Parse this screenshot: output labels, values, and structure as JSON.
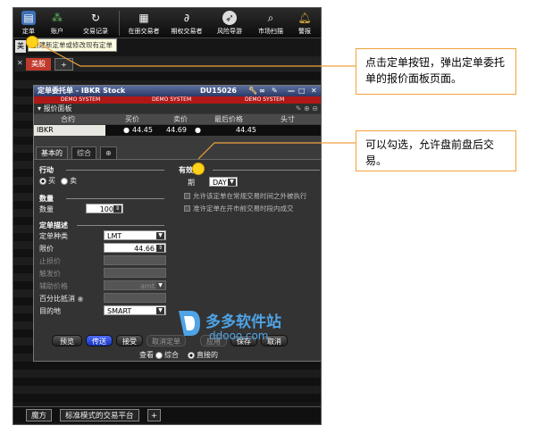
{
  "colors": {
    "accent": "#ffd21a",
    "callout_border": "#f2a23c",
    "title_blue": "#2c3a66",
    "demo_red": "#b01818",
    "button_blue": "#1633bb",
    "watermark": "#4ea4e6"
  },
  "toolbar": {
    "buttons": [
      {
        "label": "定单",
        "icon": "order-icon"
      },
      {
        "label": "账户",
        "icon": "account-icon"
      },
      {
        "label": "交易记录",
        "icon": "trade-log-icon"
      },
      {
        "label": "在册交易者",
        "icon": "book-trader-icon"
      },
      {
        "label": "期权交易者",
        "icon": "option-trader-icon"
      },
      {
        "label": "风险导游",
        "icon": "risk-navigator-icon"
      },
      {
        "label": "市场扫描",
        "icon": "market-scanner-icon"
      },
      {
        "label": "警报",
        "icon": "alert-icon"
      }
    ]
  },
  "tooltip": "创建新定单或修改现有定单",
  "stub_tab": "美",
  "workspace_tabs": {
    "active": "美股",
    "add": "+"
  },
  "order_window": {
    "title": "定单委托单 - IBKR Stock",
    "account": "DU15026",
    "demo_text": "DEMO SYSTEM",
    "quote_panel_title": "报价面板",
    "columns": [
      "合约",
      "买价",
      "卖价",
      "最后价格",
      "头寸"
    ],
    "row": {
      "contract": "IBKR",
      "bid": "44.45",
      "ask": "44.69",
      "last": "44.45",
      "position": ""
    },
    "tabs": [
      "基本的",
      "综合"
    ],
    "action_section": "行动",
    "buy": "买",
    "sell": "卖",
    "quantity_section": "数量",
    "quantity_label": "数量",
    "quantity_value": "100",
    "desc_section": "定单描述",
    "order_type_label": "定单种类",
    "order_type_value": "LMT",
    "limit_label": "限价",
    "limit_value": "44.66",
    "stop_label": "止损价",
    "trigger_label": "触发价",
    "aux_label": "辅助价格",
    "aux_value": "amt",
    "pct_label": "百分比抵消",
    "dest_label": "目的地",
    "dest_value": "SMART",
    "validity_section": "有效期",
    "tif_label": "期",
    "tif_value": "DAY",
    "check_outside_rth": "允许该定单在常规交易时间之外被执行",
    "check_premarket": "准许定单在开市前交易时段内成交",
    "buttons": {
      "preview": "预览",
      "transmit": "传送",
      "accept": "接受",
      "cancel_order": "取消定单",
      "apply": "应用",
      "save": "保存",
      "close": "取消"
    },
    "view_label": "查看",
    "view_all": "综合",
    "view_selected": "直接的"
  },
  "bottom_tabs": {
    "tab1": "魔方",
    "tab2": "标准模式的交易平台",
    "add": "+"
  },
  "callouts": {
    "one": "点击定单按钮，弹出定单委托单的报价面板页面。",
    "two": "可以勾选，允许盘前盘后交易。"
  },
  "watermark": {
    "name": "多多软件站",
    "url": "ddooo.com"
  }
}
